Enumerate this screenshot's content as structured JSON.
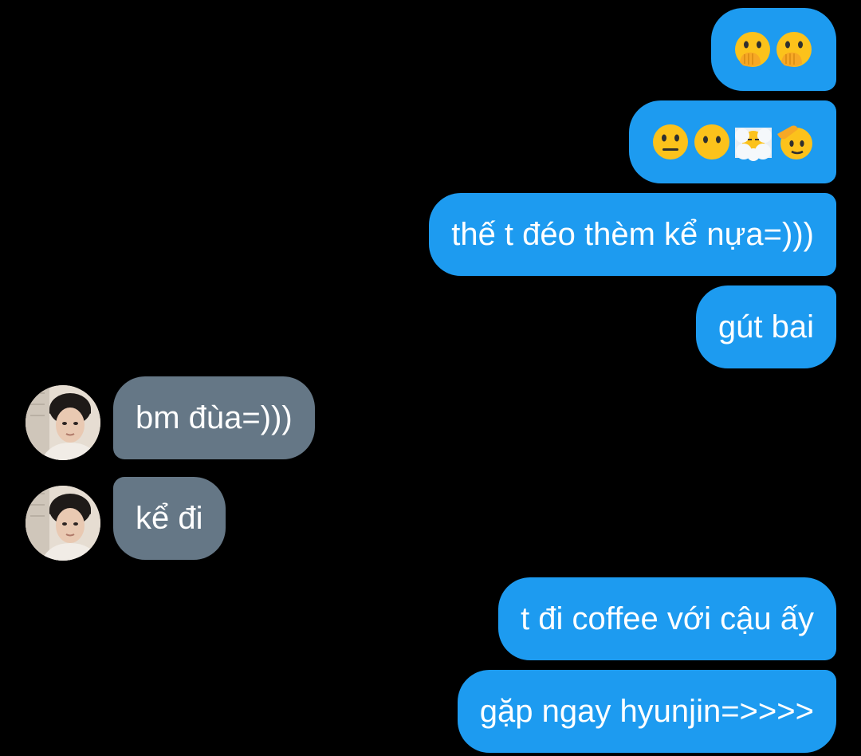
{
  "messages": {
    "m1": {
      "icons": [
        "hand-over-mouth-emoji",
        "hand-over-mouth-emoji"
      ]
    },
    "m2": {
      "icons": [
        "neutral-face-emoji",
        "face-without-mouth-emoji",
        "face-in-clouds-emoji",
        "saluting-face-emoji"
      ]
    },
    "m3": {
      "text": "thế t đéo thèm kể nựa=)))"
    },
    "m4": {
      "text": "gút bai"
    },
    "m5": {
      "text": "bm đùa=)))"
    },
    "m6": {
      "text": "kể đi"
    },
    "m7": {
      "text": "t đi coffee với cậu ấy"
    },
    "m8": {
      "text": "gặp ngay hyunjin=>>>>"
    }
  },
  "colors": {
    "background": "#000000",
    "outgoing_bubble": "#1d9bf0",
    "incoming_bubble": "#657786",
    "text": "#ffffff"
  }
}
